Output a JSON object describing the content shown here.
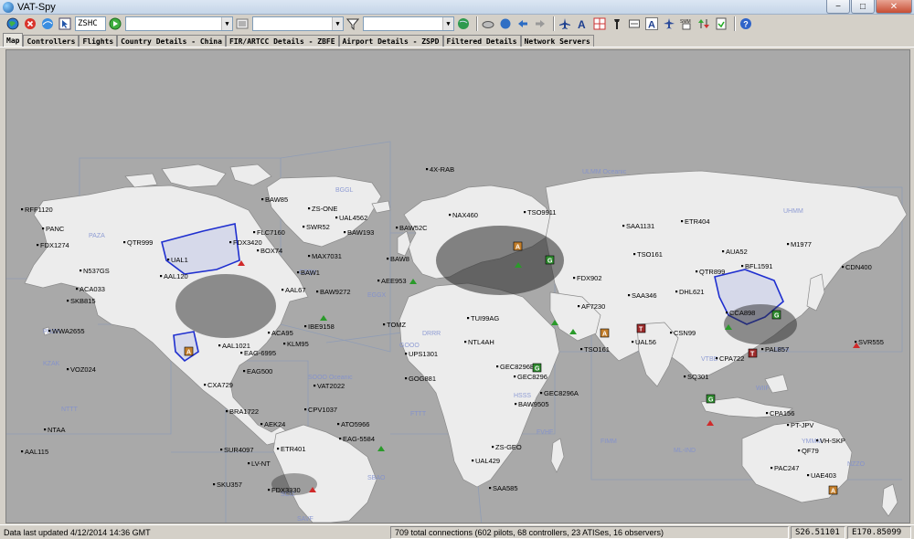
{
  "window": {
    "title": "VAT-Spy",
    "minimize": "−",
    "maximize": "□",
    "close": "✕"
  },
  "toolbar": {
    "combo1_value": "ZSHC",
    "combo2_value": "",
    "combo3_value": "",
    "combo4_value": "",
    "buttons": [
      "globe-icon",
      "stop-icon",
      "globe-refresh-icon",
      "pointer-icon",
      "go-icon",
      "filter-icon",
      "green-globe-icon",
      "cloud-icon",
      "circle-icon",
      "arrow-left-icon",
      "arrow-right-icon",
      "plane-icon",
      "font-a-icon",
      "grid-icon",
      "tower-icon",
      "rect-icon",
      "text-a-icon",
      "aircraft-scale-icon",
      "label-icon",
      "sort-icon",
      "export-icon",
      "help-icon"
    ]
  },
  "tabs": [
    {
      "label": "Map",
      "active": true
    },
    {
      "label": "Controllers"
    },
    {
      "label": "Flights"
    },
    {
      "label": "Country Details - China"
    },
    {
      "label": "FIR/ARTCC Details - ZBFE"
    },
    {
      "label": "Airport Details - ZSPD"
    },
    {
      "label": "Filtered Details"
    },
    {
      "label": "Network Servers"
    }
  ],
  "map": {
    "colors": {
      "ocean": "#a9a9a9",
      "land": "#ececec",
      "land_stroke": "#8a8a8a",
      "fir": "#7d8fb8",
      "controller": "#1f2fcf",
      "label": "#000000",
      "fir_label": "#7f8fd0"
    },
    "labels": [
      {
        "t": "4X-RAB"
      },
      {
        "t": "RFF1120"
      },
      {
        "t": "FDX1274"
      },
      {
        "t": "PANC"
      },
      {
        "t": "QTR999"
      },
      {
        "t": "N537GS"
      },
      {
        "t": "ACA033"
      },
      {
        "t": "SKB815"
      },
      {
        "t": "WWA2655"
      },
      {
        "t": "VOZ024"
      },
      {
        "t": "AAL115"
      },
      {
        "t": "NTAA"
      },
      {
        "t": "BAW85"
      },
      {
        "t": "ZS-ONE"
      },
      {
        "t": "UAL4562"
      },
      {
        "t": "FLC7160"
      },
      {
        "t": "FDX3420"
      },
      {
        "t": "SWR52"
      },
      {
        "t": "BAW193"
      },
      {
        "t": "MAX7031"
      },
      {
        "t": "BAW1"
      },
      {
        "t": "BAW9272"
      },
      {
        "t": "IBE9158"
      },
      {
        "t": "AAL67"
      },
      {
        "t": "ACA95"
      },
      {
        "t": "KLM95"
      },
      {
        "t": "AAL1021"
      },
      {
        "t": "EAG-6995"
      },
      {
        "t": "EAG500"
      },
      {
        "t": "CXA729"
      },
      {
        "t": "VAT2022"
      },
      {
        "t": "CPV1037"
      },
      {
        "t": "BRA1722"
      },
      {
        "t": "AEK24"
      },
      {
        "t": "ATO5966"
      },
      {
        "t": "EAG-5584"
      },
      {
        "t": "SUR4097"
      },
      {
        "t": "ETR401"
      },
      {
        "t": "LV-NT"
      },
      {
        "t": "FDX3330"
      },
      {
        "t": "SKU357"
      },
      {
        "t": "AEE953"
      },
      {
        "t": "BAW52C"
      },
      {
        "t": "NAX460"
      },
      {
        "t": "TSO9911"
      },
      {
        "t": "BAW8"
      },
      {
        "t": "TOMZ"
      },
      {
        "t": "UPS1301"
      },
      {
        "t": "GOG881"
      },
      {
        "t": "NTL4AH"
      },
      {
        "t": "TUI99AG"
      },
      {
        "t": "GEC8296B"
      },
      {
        "t": "GEC8296"
      },
      {
        "t": "GEC8296A"
      },
      {
        "t": "BAW9505"
      },
      {
        "t": "ZS-GEO"
      },
      {
        "t": "UAL429"
      },
      {
        "t": "SAA585"
      },
      {
        "t": "SAA1131"
      },
      {
        "t": "ETR404"
      },
      {
        "t": "AUA52"
      },
      {
        "t": "M1977"
      },
      {
        "t": "CDN400"
      },
      {
        "t": "BFL1591"
      },
      {
        "t": "QTR899"
      },
      {
        "t": "SAA346"
      },
      {
        "t": "DHL621"
      },
      {
        "t": "AF7230"
      },
      {
        "t": "FDX902"
      },
      {
        "t": "TSO161"
      },
      {
        "t": "TSO161"
      },
      {
        "t": "UAL56"
      },
      {
        "t": "CCA898"
      },
      {
        "t": "CPA722"
      },
      {
        "t": "PAL857"
      },
      {
        "t": "SVR555"
      },
      {
        "t": "CSN99"
      },
      {
        "t": "SQ301"
      },
      {
        "t": "CPA156"
      },
      {
        "t": "PT-JPV"
      },
      {
        "t": "VH-SKP"
      },
      {
        "t": "QF79"
      },
      {
        "t": "PAC247"
      },
      {
        "t": "UAE403"
      },
      {
        "t": "AAL120"
      },
      {
        "t": "UAL1"
      },
      {
        "t": "BOX74"
      }
    ],
    "fir_labels": [
      {
        "t": "BGGL"
      },
      {
        "t": "ULMM Oceanic"
      },
      {
        "t": "UHMM"
      },
      {
        "t": "PAZA"
      },
      {
        "t": "CZQX"
      },
      {
        "t": "EGGX"
      },
      {
        "t": "GOOO"
      },
      {
        "t": "DRRR"
      },
      {
        "t": "FTTT"
      },
      {
        "t": "HSSS"
      },
      {
        "t": "FIMM"
      },
      {
        "t": "VTBB"
      },
      {
        "t": "WIIF"
      },
      {
        "t": "YMMM"
      },
      {
        "t": "ML-IND"
      },
      {
        "t": "NZZO"
      },
      {
        "t": "SBAO"
      },
      {
        "t": "SCIZ"
      },
      {
        "t": "SAVF"
      },
      {
        "t": "KZAK"
      },
      {
        "t": "PHZH"
      },
      {
        "t": "NTTT"
      },
      {
        "t": "RPHI"
      },
      {
        "t": "FVHF"
      },
      {
        "t": "SOOO Oceanic"
      }
    ]
  },
  "status": {
    "updated": "Data last updated 4/12/2014 14:36 GMT",
    "connections": "709 total connections (602 pilots, 68 controllers, 23 ATISes, 16 observers)",
    "lat": "S26.51101",
    "lon": "E170.85099"
  }
}
